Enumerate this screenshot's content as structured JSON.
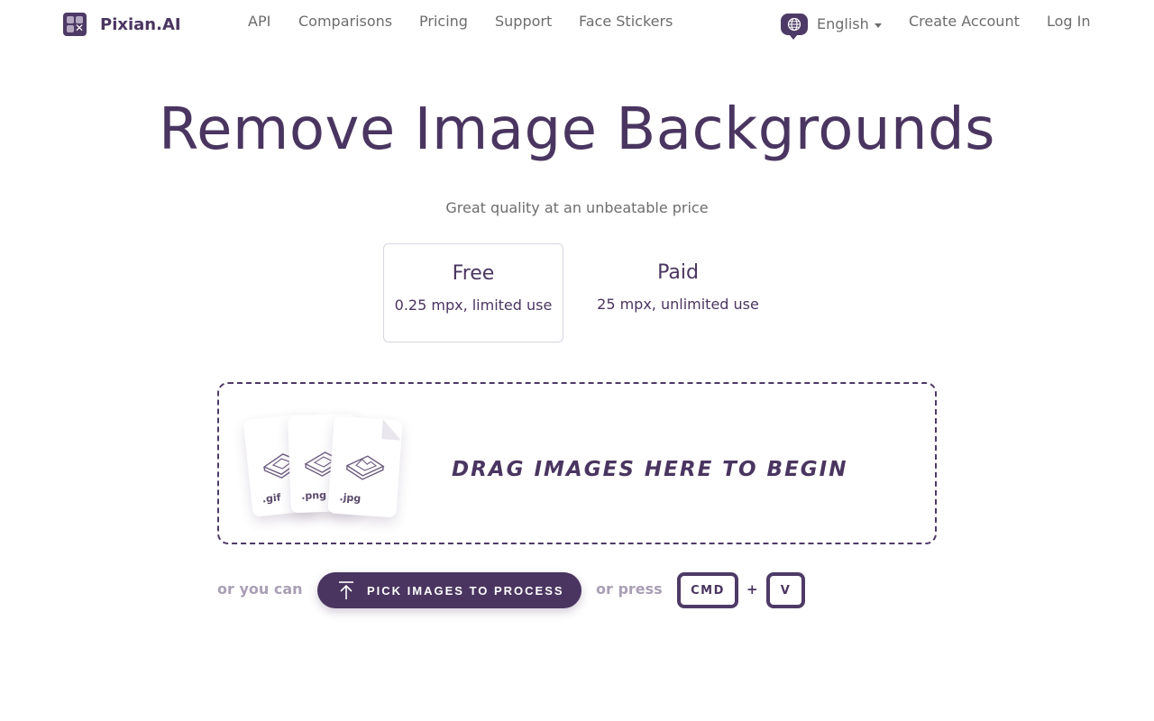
{
  "nav": {
    "brand": "Pixian.AI",
    "links": [
      {
        "id": "api",
        "label": "API"
      },
      {
        "id": "comparisons",
        "label": "Comparisons"
      },
      {
        "id": "pricing",
        "label": "Pricing"
      },
      {
        "id": "support",
        "label": "Support"
      },
      {
        "id": "face_stickers",
        "label": "Face Stickers"
      }
    ],
    "language": "English",
    "create_account": "Create Account",
    "login": "Log In"
  },
  "hero": {
    "title": "Remove Image Backgrounds",
    "subtitle": "Great quality at an unbeatable price"
  },
  "plans": [
    {
      "name": "Free",
      "desc": "0.25 mpx, limited use",
      "selected": true
    },
    {
      "name": "Paid",
      "desc": "25 mpx, unlimited use",
      "selected": false
    }
  ],
  "dropzone": {
    "text": "DRAG IMAGES HERE TO BEGIN",
    "file_types": [
      ".gif",
      ".png",
      ".jpg"
    ]
  },
  "actions": {
    "or_you_can": "or you can",
    "pick_button": "PICK IMAGES TO PROCESS",
    "or_press": "or press",
    "key_cmd": "CMD",
    "plus": "+",
    "key_v": "V"
  },
  "icons": {
    "brand": "pixian-logo-icon",
    "language": "globe-icon",
    "pick": "upload-arrow-icon"
  },
  "colors": {
    "primary": "#4a3560",
    "muted_text": "#6d6d6d",
    "faded_text": "#a99fb5",
    "border": "#d9d3df"
  }
}
